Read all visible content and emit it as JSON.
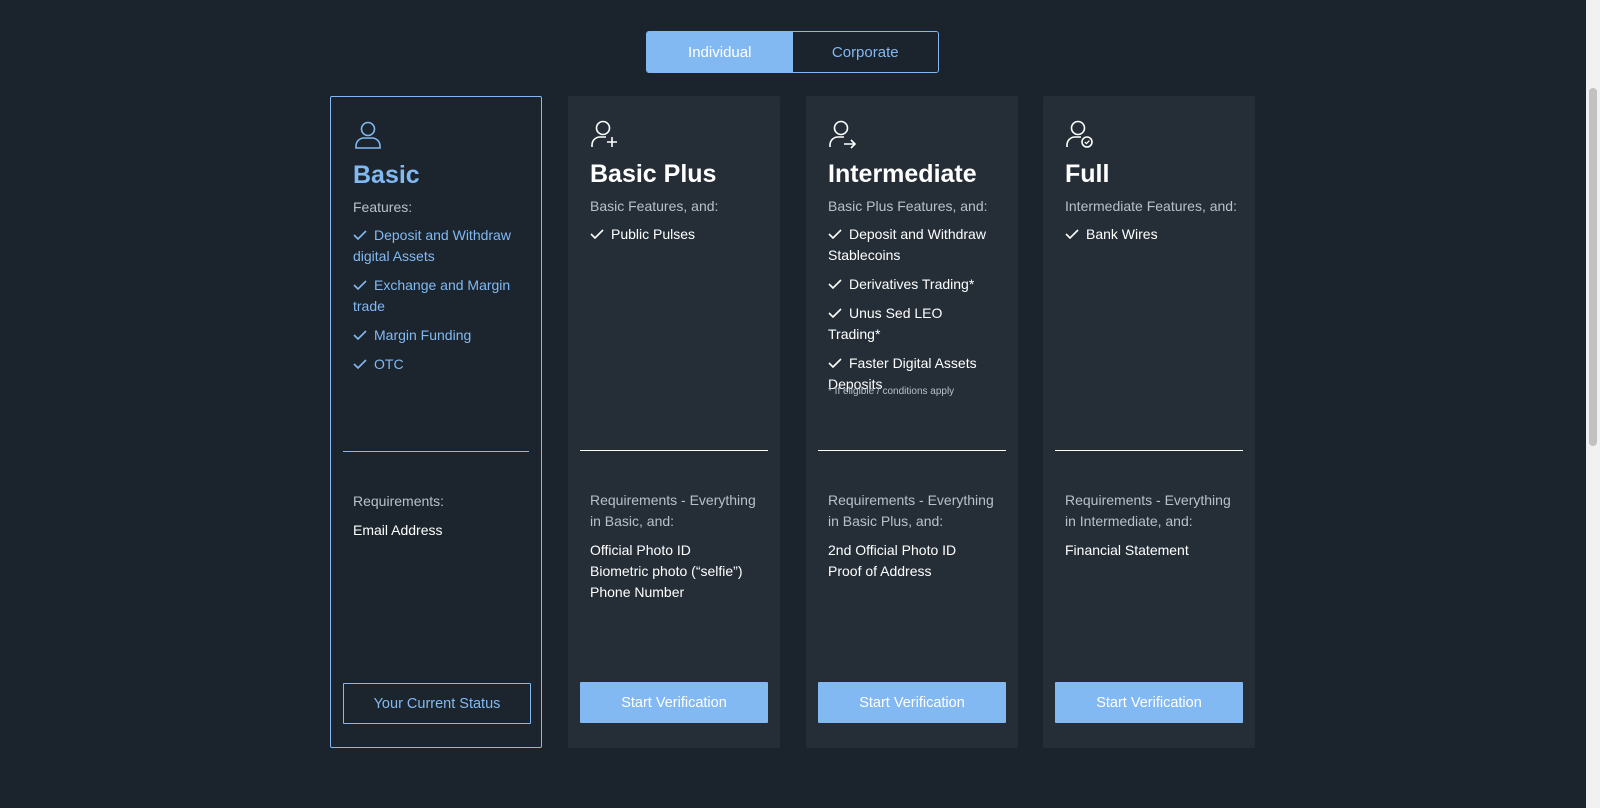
{
  "toggle": {
    "individual": "Individual",
    "corporate": "Corporate"
  },
  "colors": {
    "accent": "#82b9f3",
    "background": "#1b242c",
    "card": "#252e37"
  },
  "cards": [
    {
      "icon": "user-icon",
      "title": "Basic",
      "features_label": "Features:",
      "features": [
        "Deposit and Withdraw digital Assets",
        "Exchange and Margin trade",
        "Margin Funding",
        "OTC"
      ],
      "footnote": "",
      "requirements_label": "Requirements:",
      "requirements": [
        "Email Address"
      ],
      "button": "Your Current Status"
    },
    {
      "icon": "user-plus-icon",
      "title": "Basic Plus",
      "features_label": "Basic Features, and:",
      "features": [
        "Public Pulses"
      ],
      "footnote": "",
      "requirements_label": "Requirements - Everything in Basic, and:",
      "requirements": [
        "Official Photo ID",
        "Biometric photo (“selfie”)",
        "Phone Number"
      ],
      "button": "Start Verification"
    },
    {
      "icon": "user-arrow-icon",
      "title": "Intermediate",
      "features_label": "Basic Plus Features, and:",
      "features": [
        "Deposit and Withdraw Stablecoins",
        "Derivatives Trading*",
        "Unus Sed LEO Trading*",
        "Faster Digital Assets Deposits"
      ],
      "footnote": "* If eligible / conditions apply",
      "requirements_label": "Requirements - Everything in Basic Plus, and:",
      "requirements": [
        "2nd Official Photo ID",
        "Proof of Address"
      ],
      "button": "Start Verification"
    },
    {
      "icon": "user-check-icon",
      "title": "Full",
      "features_label": "Intermediate Features, and:",
      "features": [
        "Bank Wires"
      ],
      "footnote": "",
      "requirements_label": "Requirements - Everything in Intermediate, and:",
      "requirements": [
        "Financial Statement"
      ],
      "button": "Start Verification"
    }
  ]
}
